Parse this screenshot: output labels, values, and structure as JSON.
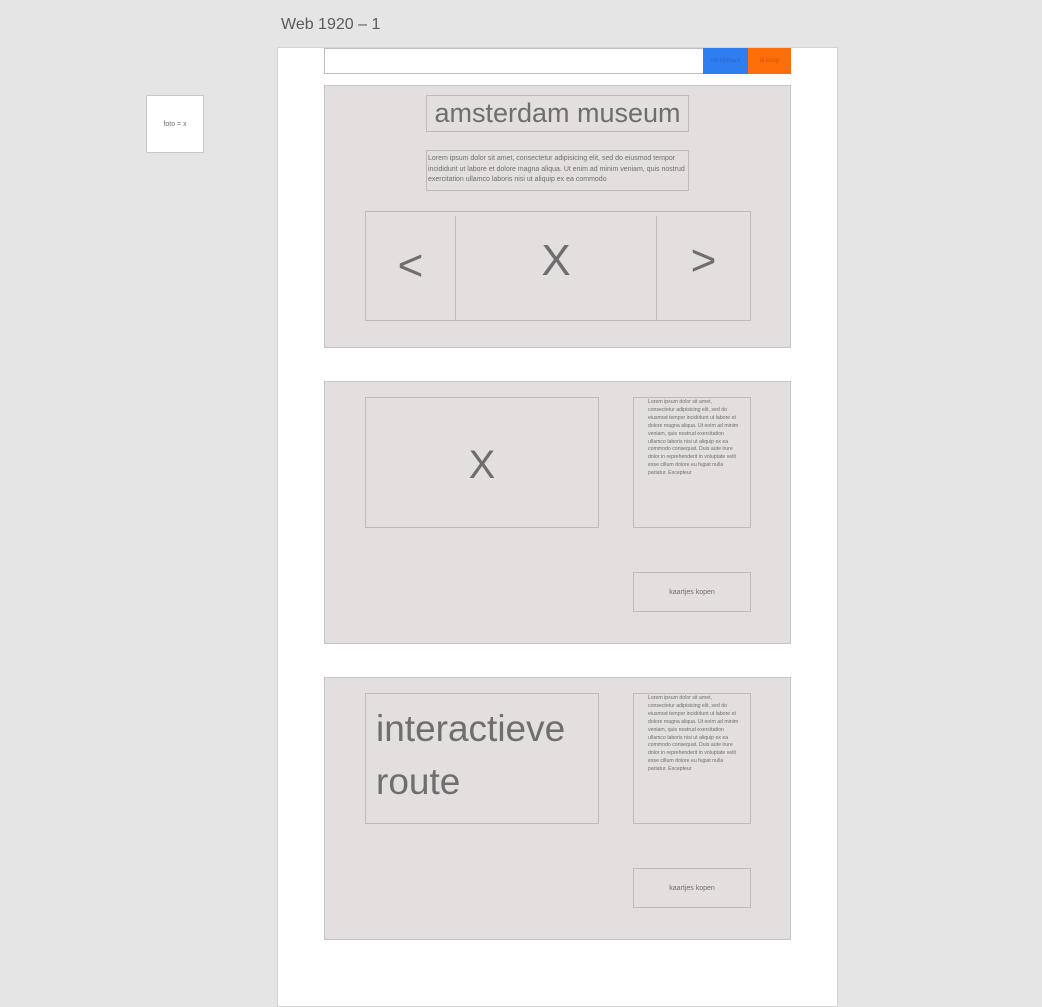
{
  "artboard": {
    "title": "Web 1920 – 1"
  },
  "legend": {
    "label": "foto = x"
  },
  "topbar": {
    "blue_button": "zie klikbare",
    "orange_button": "el knop"
  },
  "hero": {
    "title": "amsterdam museum",
    "text": "Lorem ipsum dolor sit amet, consectetur adipisicing elit, sed do eiusmod tempor incididunt ut labore et dolore magna aliqua. Ut enim ad minim veniam, quis nostrud exercitation ullamco laboris nisi ut aliquip ex ea commodo",
    "prev": "<",
    "image": "X",
    "next": ">"
  },
  "sections": [
    {
      "image": "X",
      "text": "Lorem ipsum dolor sit amet, consectetur adipisicing elit, sed do eiusmod tempor incididunt ut labore et dolore magna aliqua. Ut enim ad minim veniam, quis nostrud exercitation ullamco laboris nisi ut aliquip ex ea commodo consequat. Duis aute irure dolor in reprehenderit in voluptate velit esse cillum dolore eu fugiat nulla pariatur. Excepteur",
      "button": "kaartjes kopen"
    },
    {
      "title": "interactieve route",
      "text": "Lorem ipsum dolor sit amet, consectetur adipisicing elit, sed do eiusmod tempor incididunt ut labore et dolore magna aliqua. Ut enim ad minim veniam, quis nostrud exercitation ullamco laboris nisi ut aliquip ex ea commodo consequat. Duis aute irure dolor in reprehenderit in voluptate velit esse cillum dolore eu fugiat nulla pariatur. Excepteur",
      "button": "kaartjes kopen"
    }
  ],
  "colors": {
    "canvas": "#e5e5e5",
    "section_bg": "#e2dfde",
    "blue": "#2f7ef1",
    "orange": "#fd6d0a"
  }
}
